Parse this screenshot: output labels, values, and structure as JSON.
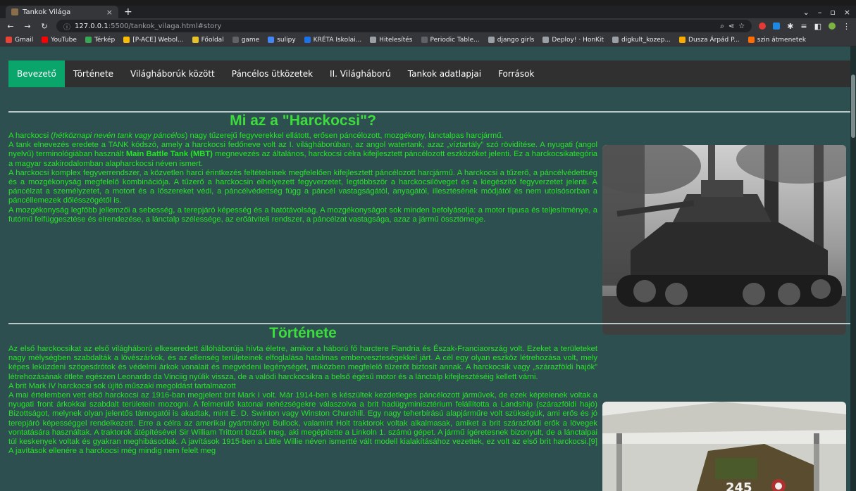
{
  "browser": {
    "tab_title": "Tankok Világa",
    "tab_close": "×",
    "new_tab": "+",
    "url_host": "127.0.0.1",
    "url_path": ":5500/tankok_vilaga.html#story",
    "window_controls": [
      "⌄",
      "–",
      "▫",
      "×"
    ]
  },
  "bookmarks": [
    {
      "label": "Gmail",
      "color": "#ea4335"
    },
    {
      "label": "YouTube",
      "color": "#ff0000"
    },
    {
      "label": "Térkép",
      "color": "#34a853"
    },
    {
      "label": "[P-ACE] Webol...",
      "color": "#fbbc05"
    },
    {
      "label": "Főoldal",
      "color": "#e6c229"
    },
    {
      "label": "game",
      "color": "#5f6368"
    },
    {
      "label": "sulipy",
      "color": "#4285f4"
    },
    {
      "label": "KRÉTA Iskolai...",
      "color": "#1a73e8"
    },
    {
      "label": "Hitelesítés",
      "color": "#9aa0a6"
    },
    {
      "label": "Periodic Table...",
      "color": "#5f6368"
    },
    {
      "label": "django girls",
      "color": "#9aa0a6"
    },
    {
      "label": "Deploy! · HonKit",
      "color": "#9aa0a6"
    },
    {
      "label": "digkult_kozep...",
      "color": "#9aa0a6"
    },
    {
      "label": "Dusza Árpád P...",
      "color": "#f9ab00"
    },
    {
      "label": "szin átmenetek",
      "color": "#ff6d01"
    }
  ],
  "nav": {
    "items": [
      "Bevezető",
      "Története",
      "Világháborúk között",
      "Páncélos ütközetek",
      "II. Világháború",
      "Tankok adatlapjai",
      "Források"
    ],
    "active": 0,
    "active_color": "#0aa56b"
  },
  "intro": {
    "title": "Mi az a \"Harckocsi\"?",
    "p1_before": "A harckocsi (",
    "p1_em": "hétköznapi nevén tank vagy páncélos",
    "p1_after": ") nagy tűzerejű fegyverekkel ellátott, erősen páncélozott, mozgékony, lánctalpas harcjármű.",
    "p2_before": "A tank elnevezés eredete a TANK kódszó, amely a harckocsi fedőneve volt az I. világháborúban, az angol watertank, azaz „víztartály” szó rövidítése. A nyugati (angol nyelvű) terminológiában használt ",
    "p2_bold": "Main Battle Tank (MBT)",
    "p2_after": " megnevezés az általános, harckocsi célra kifejlesztett páncélozott eszközöket jelenti. Ez a harckocsikategória a magyar szakirodalomban alapharckocsi néven ismert.",
    "p3": "A harckocsi komplex fegyverrendszer, a közvetlen harci érintkezés feltételeinek megfelelően kifejlesztett páncélozott harcjármű. A harckocsi a tűzerő, a páncélvédettség és a mozgékonyság megfelelő kombinációja. A tűzerő a harckocsin elhelyezett fegyverzetet, legtöbbször a harckocsilöveget és a kiegészítő fegyverzetet jelenti. A páncélzat a személyzetet, a motort és a lőszereket védi, a páncélvédettség függ a páncél vastagságától, anyagától, illesztésének módjától és nem utolsósorban a páncéllemezek dőlésszögétől is.",
    "p4": "A mozgékonyság legfőbb jellemzői a sebesség, a terepjáró képesség és a hatótávolság. A mozgékonyságot sok minden befolyásolja: a motor típusa és teljesítménye, a futómű felfüggesztése és elrendezése, a lánctalp szélessége, az erőátviteli rendszer, a páncélzat vastagsága, azaz a jármű össztömege."
  },
  "history": {
    "title": "Története",
    "p1": "Az első harckocsikat az első világháború elkeseredett állóháborúja hívta életre, amikor a háború fő harctere Flandria és Észak-Franciaország volt. Ezeket a területeket nagy mélységben szabdalták a lövészárkok, és az ellenség területeinek elfoglalása hatalmas emberveszteségekkel járt. A cél egy olyan eszköz létrehozása volt, mely képes leküzdeni szögesdrótok és védelmi árkok vonalait és megvédeni legénységét, miközben megfelelő tűzerőt biztosít annak. A harckocsik vagy „szárazföldi hajók” létrehozásának ötlete egészen Leonardo da Vinciig nyúlik vissza, de a valódi harckocsikra a belső égésű motor és a lánctalp kifejlesztéséig kellett várni.",
    "p2": "A brit Mark IV harckocsi sok újító műszaki megoldást tartalmazott",
    "p3": "A mai értelemben vett első harckocsi az 1916-ban megjelent brit Mark I volt. Már 1914-ben is készültek kezdetleges páncélozott járművek, de ezek képtelenek voltak a nyugati front árkokkal szabdalt területein mozogni. A felmerülő katonai nehézségekre válaszolva a brit hadügyminisztérium felállította a Landship (szárazföldi hajó) Bizottságot, melynek olyan jelentős támogatói is akadtak, mint E. D. Swinton vagy Winston Churchill. Egy nagy teherbírású alapjárműre volt szükségük, ami erős és jó terepjáró képességgel rendelkezett. Erre a célra az amerikai gyártmányú Bullock, valamint Holt traktorok voltak alkalmasak, amiket a brit szárazföldi erők a lövegek vontatására használtak. A traktorok átépítésével Sir William Trittont bízták meg, aki megépítette a Linkoln 1. számú gépet. A jármű ígéretesnek bizonyult, de a lánctalpai túl keskenyek voltak és gyakran meghibásodtak. A javítások 1915-ben a Little Willie néven ismertté vált modell kialakításához vezettek, ez volt az első brit harckocsi.[9] A javítások ellenére a harckocsi még mindig nem felelt meg",
    "tank_number": "245"
  },
  "colors": {
    "page_bg": "#2e4f4f",
    "text_green": "#26e626",
    "title_green": "#3ddc3d",
    "navbar_bg": "#303030"
  }
}
